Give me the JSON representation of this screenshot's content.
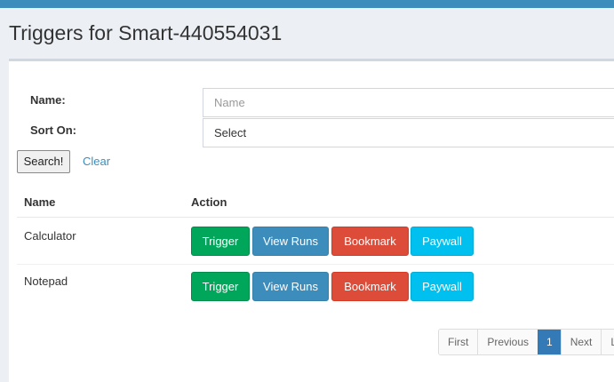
{
  "header": {
    "title": "Triggers for Smart-440554031"
  },
  "search": {
    "name_label": "Name:",
    "name_placeholder": "Name",
    "sort_label": "Sort On:",
    "sort_value": "Select",
    "search_button": "Search!",
    "clear_link": "Clear"
  },
  "table": {
    "columns": [
      "Name",
      "Action"
    ],
    "rows": [
      {
        "name": "Calculator"
      },
      {
        "name": "Notepad"
      }
    ],
    "actions": {
      "trigger": "Trigger",
      "view_runs": "View Runs",
      "bookmark": "Bookmark",
      "paywall": "Paywall"
    }
  },
  "pagination": {
    "first": "First",
    "previous": "Previous",
    "current": "1",
    "next": "Next",
    "last": "La"
  },
  "colors": {
    "topbar": "#3c8dbc",
    "trigger": "#00a65a",
    "view_runs": "#3c8dbc",
    "bookmark": "#dd4b39",
    "paywall": "#00c0ef"
  }
}
